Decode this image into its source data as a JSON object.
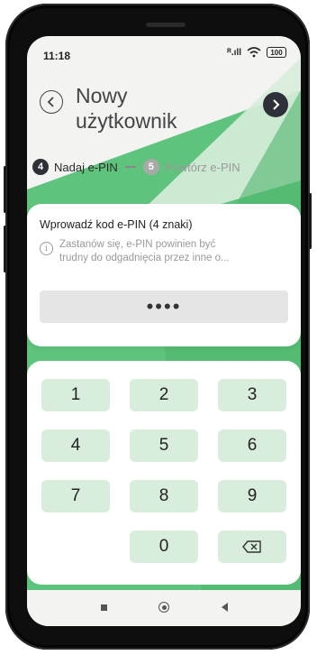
{
  "status_bar": {
    "time": "11:18",
    "signal_label": "ᴿ.ıll",
    "battery_level": "100"
  },
  "header": {
    "title_line1": "Nowy",
    "title_line2": "użytkownik"
  },
  "steps": [
    {
      "number": "4",
      "label": "Nadaj e-PIN",
      "state": "active"
    },
    {
      "number": "5",
      "label": "Powtórz e-PIN",
      "state": "inactive"
    }
  ],
  "pin_card": {
    "title": "Wprowadź kod e-PIN (4 znaki)",
    "info_line1": "Zastanów się, e-PIN powinien być",
    "info_line2": "trudny do odgadnięcia przez inne o...",
    "masked_value": "••••"
  },
  "keypad": {
    "keys": [
      "1",
      "2",
      "3",
      "4",
      "5",
      "6",
      "7",
      "8",
      "9",
      "0"
    ]
  },
  "colors": {
    "brand_green": "#5ec37c",
    "key_bg": "#d8eddb",
    "dark": "#2d3037"
  }
}
